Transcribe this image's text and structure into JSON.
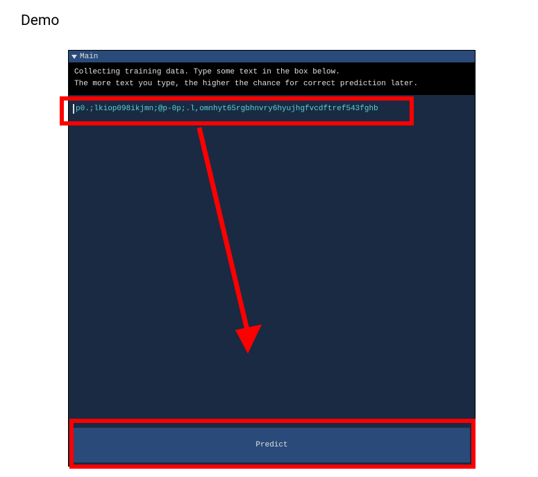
{
  "page": {
    "title": "Demo"
  },
  "window": {
    "title": "Main",
    "info_line1": "Collecting training data. Type some text in the box below.",
    "info_line2": "The more text you type, the higher the chance for correct prediction later.",
    "input_value": "p0.;lkiop098ikjmn;@p-0p;.l,omnhyt65rgbhnvry6hyujhgfvcdftref543fghb",
    "predict_label": "Predict"
  }
}
